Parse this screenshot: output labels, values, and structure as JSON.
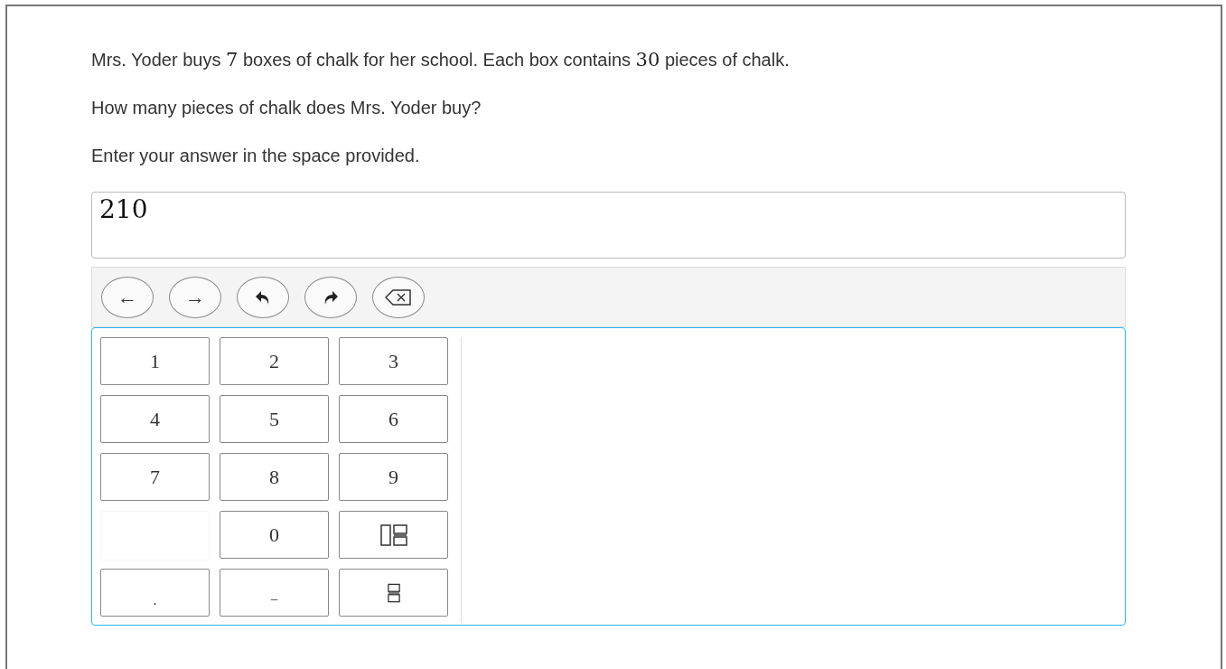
{
  "question": [
    [
      {
        "kind": "text",
        "text": "Mrs. Yoder buys "
      },
      {
        "kind": "math",
        "text": "7"
      },
      {
        "kind": "text",
        "text": " boxes of chalk for her school. Each box contains "
      },
      {
        "kind": "math",
        "text": "30"
      },
      {
        "kind": "text",
        "text": " pieces of chalk."
      }
    ],
    [
      {
        "kind": "text",
        "text": "How many pieces of chalk does Mrs. Yoder buy?"
      }
    ],
    [
      {
        "kind": "text",
        "text": "Enter your answer in the space provided."
      }
    ]
  ],
  "answer": {
    "value": "210"
  },
  "toolbar": [
    {
      "kind": "text",
      "label": "←"
    },
    {
      "kind": "text",
      "label": "→"
    },
    {
      "kind": "undo"
    },
    {
      "kind": "redo"
    },
    {
      "kind": "backspace"
    }
  ],
  "keys": [
    {
      "kind": "text",
      "label": "1"
    },
    {
      "kind": "text",
      "label": "2"
    },
    {
      "kind": "text",
      "label": "3"
    },
    {
      "kind": "text",
      "label": "4"
    },
    {
      "kind": "text",
      "label": "5"
    },
    {
      "kind": "text",
      "label": "6"
    },
    {
      "kind": "text",
      "label": "7"
    },
    {
      "kind": "text",
      "label": "8"
    },
    {
      "kind": "text",
      "label": "9"
    },
    {
      "kind": "blank"
    },
    {
      "kind": "text",
      "label": "0"
    },
    {
      "kind": "mixed-fraction"
    },
    {
      "kind": "dot",
      "label": "."
    },
    {
      "kind": "dot",
      "label": "−"
    },
    {
      "kind": "fraction"
    }
  ]
}
